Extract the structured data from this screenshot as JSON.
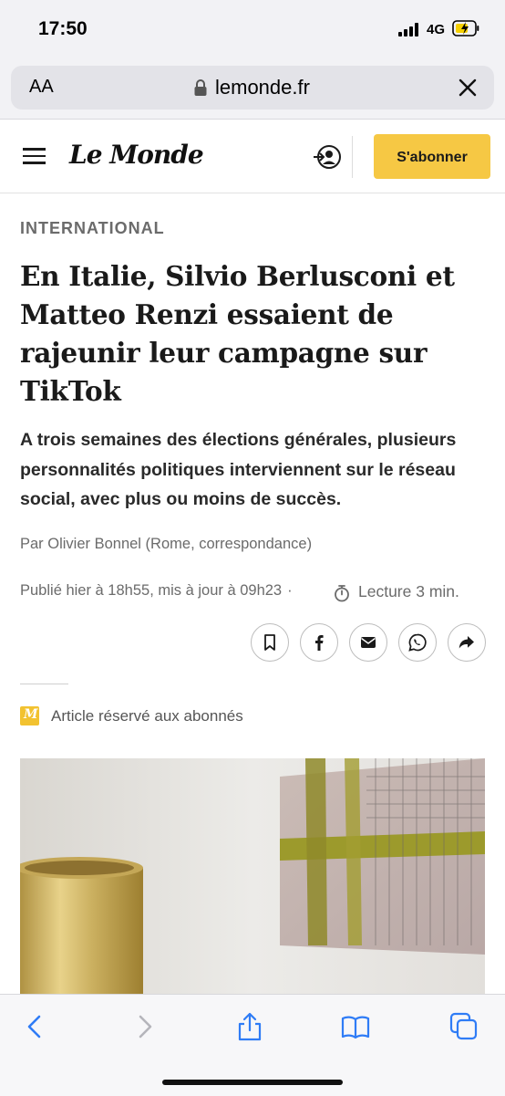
{
  "status_bar": {
    "time": "17:50",
    "network": "4G"
  },
  "browser": {
    "text_size_button": "AA",
    "url": "lemonde.fr"
  },
  "site_header": {
    "logo": "Le Monde",
    "subscribe_label": "S'abonner"
  },
  "article": {
    "rubric": "INTERNATIONAL",
    "headline": "En Italie, Silvio Berlusconi et Matteo Renzi essaient de rajeunir leur campagne sur TikTok",
    "lead": "A trois semaines des élections générales, plusieurs personnalités politiques interviennent sur le réseau social, avec plus ou moins de succès.",
    "author": "Par Olivier Bonnel (Rome, correspondance)",
    "published": "Publié hier à 18h55, mis à jour à 09h23",
    "separator": "·",
    "reading_time": "Lecture 3 min.",
    "subscriber_badge": "M",
    "subscriber_note": "Article réservé aux abonnés"
  },
  "share_buttons": [
    "bookmark-icon",
    "facebook-icon",
    "email-icon",
    "whatsapp-icon",
    "share-arrow-icon"
  ],
  "colors": {
    "subscribe_bg": "#f6c844",
    "browser_chrome": "#f2f2f5",
    "link_blue": "#2f7cf6"
  }
}
